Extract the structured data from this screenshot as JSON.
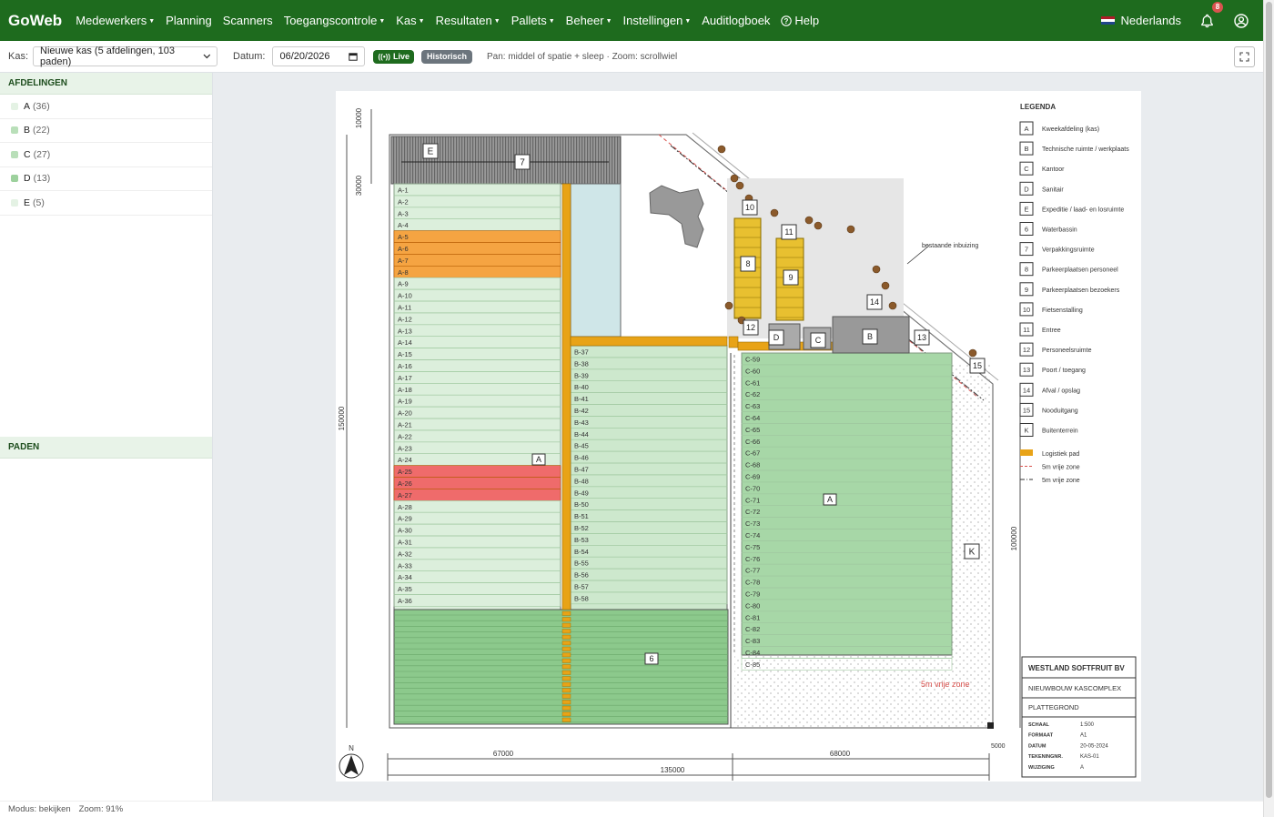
{
  "navbar": {
    "brand": "GoWeb",
    "items": [
      {
        "label": "Medewerkers",
        "dropdown": true
      },
      {
        "label": "Planning",
        "dropdown": false
      },
      {
        "label": "Scanners",
        "dropdown": false
      },
      {
        "label": "Toegangscontrole",
        "dropdown": true
      },
      {
        "label": "Kas",
        "dropdown": true
      },
      {
        "label": "Resultaten",
        "dropdown": true
      },
      {
        "label": "Pallets",
        "dropdown": true
      },
      {
        "label": "Beheer",
        "dropdown": true
      },
      {
        "label": "Instellingen",
        "dropdown": true
      },
      {
        "label": "Auditlogboek",
        "dropdown": false
      },
      {
        "label": "Help",
        "dropdown": false,
        "icon": "question-circle-icon"
      }
    ],
    "language": "Nederlands",
    "notification_count": "8",
    "bg_color": "#1e6b1e"
  },
  "toolbar": {
    "kas_label": "Kas:",
    "kas_value": "Nieuwe kas (5 afdelingen, 103 paden)",
    "datum_label": "Datum:",
    "datum_value": "06/20/2026",
    "live_label": "Live",
    "historisch_label": "Historisch",
    "hint": "Pan: middel of spatie + sleep · Zoom: scrollwiel"
  },
  "sidebar": {
    "afdelingen_header": "AFDELINGEN",
    "afdelingen": [
      {
        "label": "A",
        "count": "(36)",
        "color": "#e4f2e4"
      },
      {
        "label": "B",
        "count": "(22)",
        "color": "#b9dfb9"
      },
      {
        "label": "C",
        "count": "(27)",
        "color": "#b9dfb9"
      },
      {
        "label": "D",
        "count": "(13)",
        "color": "#9dd19d"
      },
      {
        "label": "E",
        "count": "(5)",
        "color": "#e4f2e4"
      }
    ],
    "paden_header": "PADEN"
  },
  "plan": {
    "dims": {
      "left_top": "10000",
      "left_mid": "30000",
      "left_total": "150000",
      "right_side": "100000",
      "bottom_left": "67000",
      "bottom_right": "68000",
      "bottom_total": "135000",
      "bottom_corner": "5000"
    },
    "north": "N",
    "zone_labels": {
      "a_west": "A",
      "a_east": "A",
      "six": "6",
      "e": "E",
      "seven": "7",
      "k": "K"
    },
    "markers": [
      "10",
      "11",
      "8",
      "9",
      "14",
      "12",
      "D",
      "C",
      "B",
      "13",
      "15"
    ],
    "bestaande": "bestaande inbuizing",
    "vrije_zone": "5m vrije zone",
    "highlight_orange": [
      "A-5",
      "A-6",
      "A-7",
      "A-8"
    ],
    "highlight_red": [
      "A-25",
      "A-26",
      "A-27"
    ],
    "legend_title": "LEGENDA",
    "legend": [
      {
        "key": "A",
        "label": "Kweekafdeling (kas)"
      },
      {
        "key": "B",
        "label": "Technische ruimte / werkplaats"
      },
      {
        "key": "C",
        "label": "Kantoor"
      },
      {
        "key": "D",
        "label": "Sanitair"
      },
      {
        "key": "E",
        "label": "Expeditie / laad- en losruimte"
      },
      {
        "key": "6",
        "label": "Waterbassin"
      },
      {
        "key": "7",
        "label": "Verpakkingsruimte"
      },
      {
        "key": "8",
        "label": "Parkeerplaatsen personeel"
      },
      {
        "key": "9",
        "label": "Parkeerplaatsen bezoekers"
      },
      {
        "key": "10",
        "label": "Fietsenstalling"
      },
      {
        "key": "11",
        "label": "Entree"
      },
      {
        "key": "12",
        "label": "Personeelsruimte"
      },
      {
        "key": "13",
        "label": "Poort / toegang"
      },
      {
        "key": "14",
        "label": "Afval / opslag"
      },
      {
        "key": "15",
        "label": "Nooduitgang"
      },
      {
        "key": "K",
        "label": "Buitenterrein"
      }
    ],
    "legend_lines": [
      {
        "label": "Logistiek pad",
        "color": "#e8a317",
        "style": "fill"
      },
      {
        "label": "5m vrije zone",
        "color": "#d9534f",
        "style": "dash"
      },
      {
        "label": "5m vrije zone",
        "color": "#333333",
        "style": "dashdot"
      }
    ],
    "title_block": {
      "company": "WESTLAND SOFTFRUIT BV",
      "project": "NIEUWBOUW KASCOMPLEX",
      "drawing": "PLATTEGROND",
      "rows": [
        {
          "k": "SCHAAL",
          "v": "1:500"
        },
        {
          "k": "FORMAAT",
          "v": "A1"
        },
        {
          "k": "DATUM",
          "v": "20-05-2024"
        },
        {
          "k": "TEKENINGNR.",
          "v": "KAS-01"
        },
        {
          "k": "WIJZIGING",
          "v": "A"
        }
      ]
    }
  },
  "statusbar": {
    "mode": "Modus: bekijken",
    "zoom": "Zoom: 91%"
  }
}
